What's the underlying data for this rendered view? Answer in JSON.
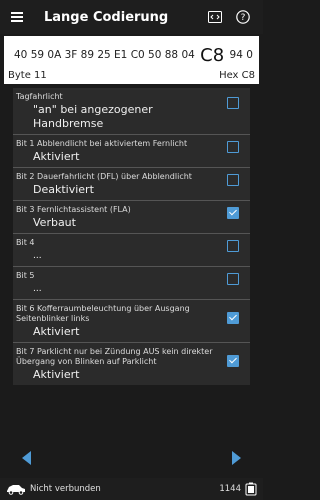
{
  "header": {
    "title": "Lange Codierung",
    "icons": [
      "menu-icon",
      "code-icon",
      "help-icon"
    ]
  },
  "hex": {
    "bytes_before": "40 59 0A 3F 89 25 E1 C0 50 88 04",
    "selected": "C8",
    "bytes_after": "94 0",
    "byte_label": "Byte 11",
    "hex_label": "Hex C8"
  },
  "rows": [
    {
      "label": "Tagfahrlicht",
      "value": "\"an\" bei angezogener Handbremse",
      "checked": false
    },
    {
      "label": "Bit 1 Abblendlicht bei aktiviertem Fernlicht",
      "value": "Aktiviert",
      "checked": false
    },
    {
      "label": "Bit 2 Dauerfahrlicht (DFL) über Abblendlicht",
      "value": "Deaktiviert",
      "checked": false
    },
    {
      "label": "Bit 3 Fernlichtassistent (FLA)",
      "value": "Verbaut",
      "checked": true
    },
    {
      "label": "Bit 4",
      "value": "...",
      "checked": false
    },
    {
      "label": "Bit 5",
      "value": "...",
      "checked": false
    },
    {
      "label": "Bit  6 Kofferraumbeleuchtung über Ausgang Seitenblinker links",
      "value": "Aktiviert",
      "checked": true
    },
    {
      "label": "Bit 7 Parklicht nur bei Zündung AUS kein direkter Übergang von Blinken auf Parklicht",
      "value": "Aktiviert",
      "checked": true
    }
  ],
  "status": {
    "connection": "Nicht verbunden",
    "count": "1144"
  },
  "colors": {
    "accent": "#4f9bd6",
    "background": "#1b1b1b",
    "panel": "#2b2b2b"
  }
}
